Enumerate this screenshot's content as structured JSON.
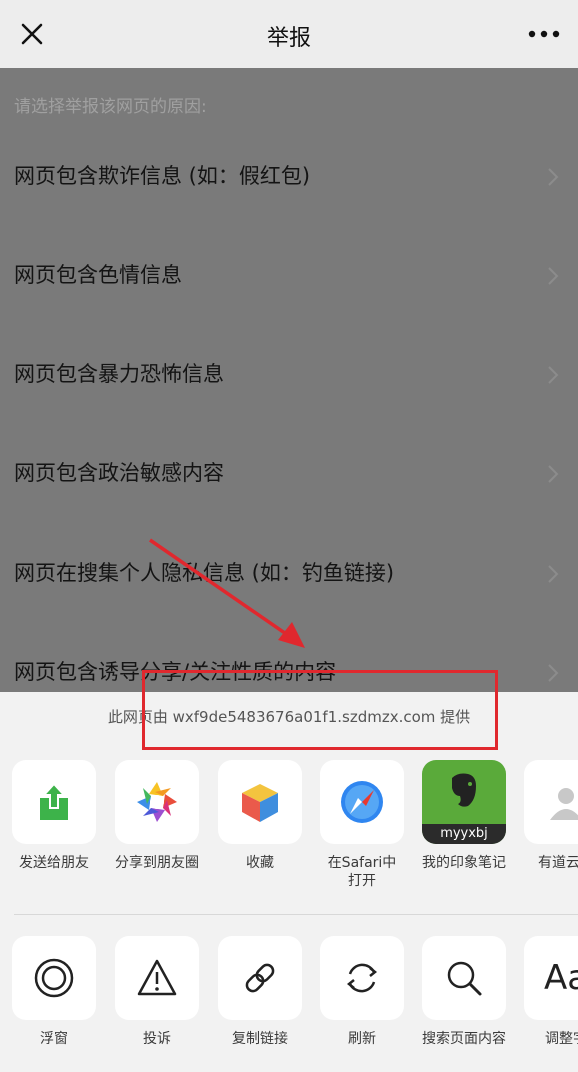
{
  "navbar": {
    "title": "举报",
    "close_icon": "close-icon",
    "more_icon": "more-icon"
  },
  "content": {
    "hint": "请选择举报该网页的原因:",
    "reasons": [
      {
        "label": "网页包含欺诈信息 (如：假红包)"
      },
      {
        "label": "网页包含色情信息"
      },
      {
        "label": "网页包含暴力恐怖信息"
      },
      {
        "label": "网页包含政治敏感内容"
      },
      {
        "label": "网页在搜集个人隐私信息 (如：钓鱼链接)"
      },
      {
        "label": "网页包含诱导分享/关注性质的内容"
      }
    ]
  },
  "sheet": {
    "provider": "此网页由 wxf9de5483676a01f1.szdmzx.com 提供",
    "share_row": [
      {
        "label": "发送给朋友",
        "icon": "send-to-friend-icon"
      },
      {
        "label": "分享到朋友圈",
        "icon": "moments-icon"
      },
      {
        "label": "收藏",
        "icon": "favorite-cube-icon"
      },
      {
        "label": "在Safari中",
        "label2": "打开",
        "icon": "safari-icon"
      },
      {
        "label": "我的印象笔记",
        "icon": "evernote-icon",
        "badge": "myyxbj"
      },
      {
        "label": "有道云笔",
        "icon": "youdao-icon"
      }
    ],
    "action_row": [
      {
        "label": "浮窗",
        "icon": "float-window-icon"
      },
      {
        "label": "投诉",
        "icon": "warning-icon"
      },
      {
        "label": "复制链接",
        "icon": "link-icon"
      },
      {
        "label": "刷新",
        "icon": "refresh-icon"
      },
      {
        "label": "搜索页面内容",
        "icon": "search-icon"
      },
      {
        "label": "调整字",
        "icon": "font-size-icon",
        "glyph": "Aa"
      }
    ]
  },
  "colors": {
    "annotation": "#e0282e",
    "overlay": "#7a7a7a",
    "sheet": "#f2f2f2"
  }
}
